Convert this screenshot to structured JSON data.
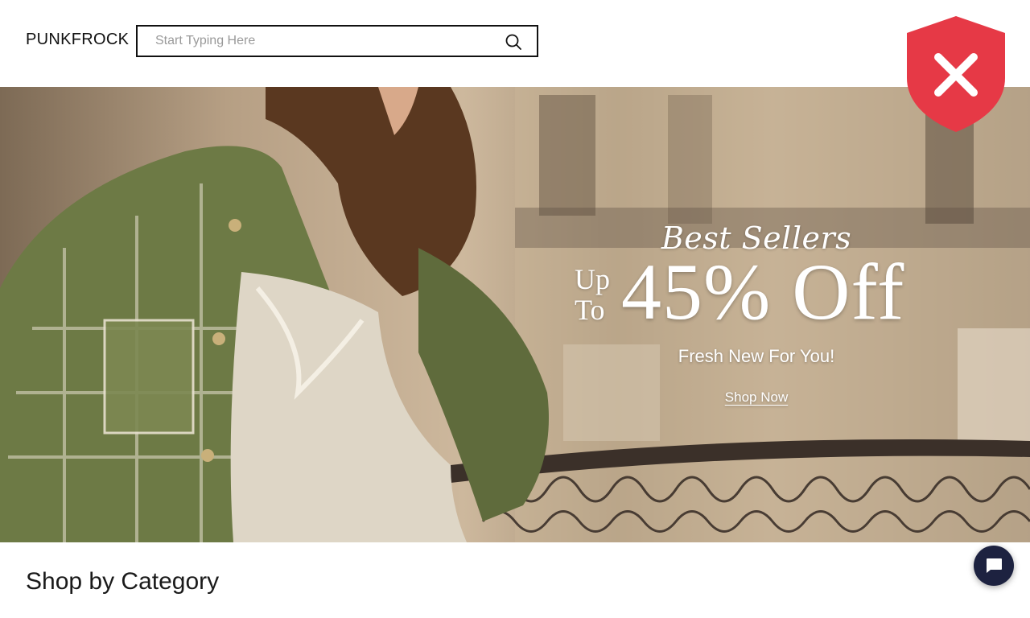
{
  "header": {
    "logo": "PUNKFROCK",
    "search": {
      "placeholder": "Start Typing Here",
      "value": ""
    },
    "search_icon": "search-icon"
  },
  "security_badge": {
    "icon": "shield-x-icon",
    "color": "#e63946"
  },
  "hero": {
    "title": "Best Sellers",
    "up_to": "Up To",
    "discount": "45% Off",
    "subtitle": "Fresh New For You!",
    "cta": "Shop Now"
  },
  "section": {
    "title": "Shop by Category"
  },
  "chat": {
    "icon": "chat-bubble-icon",
    "color": "#1d2240"
  }
}
